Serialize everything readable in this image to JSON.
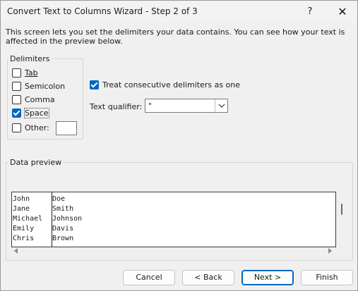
{
  "window": {
    "title": "Convert Text to Columns Wizard - Step 2 of 3",
    "help_label": "?",
    "close_label": "✕"
  },
  "instructions": "This screen lets you set the delimiters your data contains.  You can see how your text is affected in the preview below.",
  "delimiters": {
    "label": "Delimiters",
    "options": [
      {
        "label": "Tab",
        "checked": false
      },
      {
        "label": "Semicolon",
        "checked": false
      },
      {
        "label": "Comma",
        "checked": false
      },
      {
        "label": "Space",
        "checked": true
      },
      {
        "label": "Other:",
        "checked": false
      }
    ],
    "other_value": ""
  },
  "treat_consecutive": {
    "label": "Treat consecutive delimiters as one",
    "checked": true
  },
  "text_qualifier": {
    "label": "Text qualifier:",
    "value": "\""
  },
  "preview": {
    "label": "Data preview",
    "columns": [
      [
        "John",
        "Jane",
        "Michael",
        "Emily",
        "Chris"
      ],
      [
        "Doe",
        "Smith",
        "Johnson",
        "Davis",
        "Brown"
      ]
    ]
  },
  "buttons": {
    "cancel": "Cancel",
    "back": "< Back",
    "next": "Next >",
    "finish": "Finish"
  },
  "colors": {
    "accent": "#0067c0"
  }
}
